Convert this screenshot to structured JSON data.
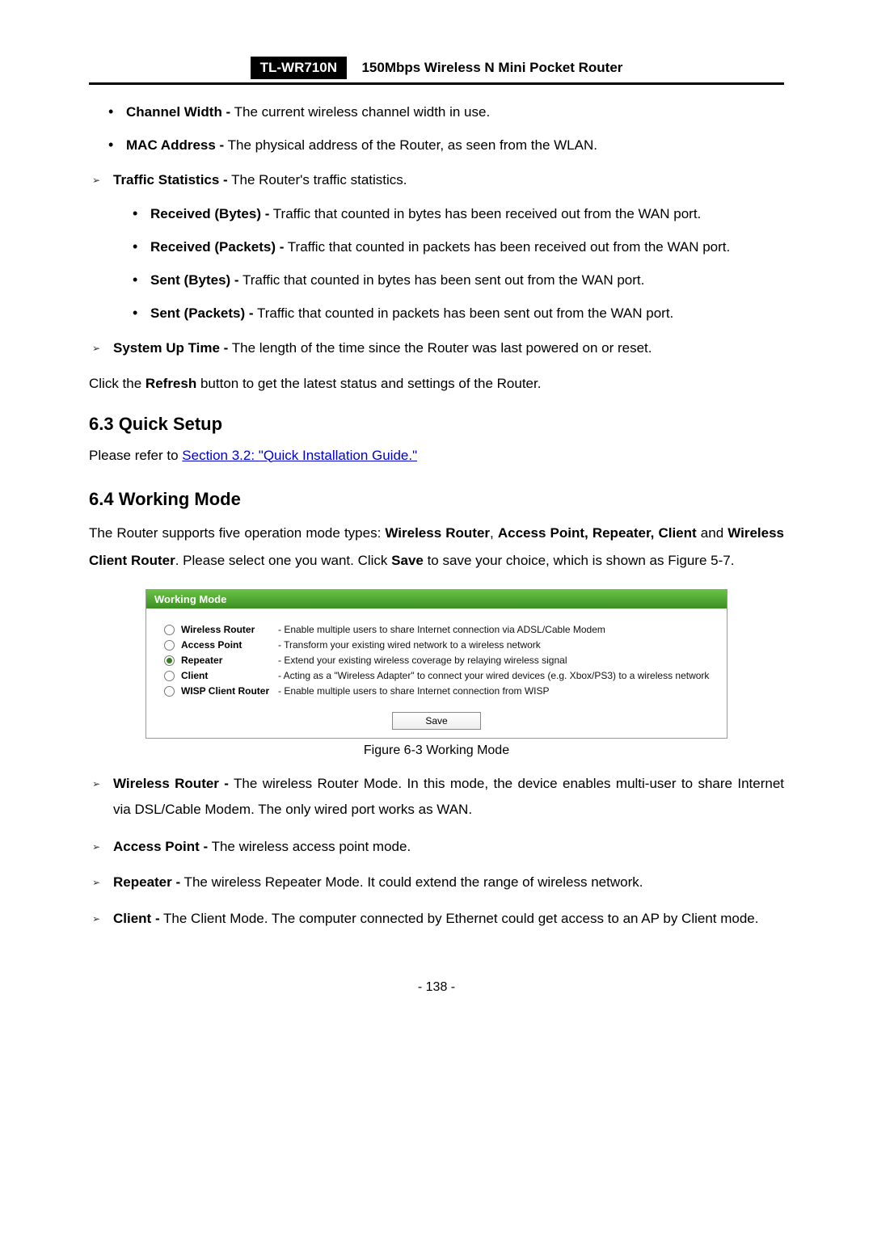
{
  "header": {
    "model": "TL-WR710N",
    "desc": "150Mbps  Wireless  N  Mini  Pocket  Router"
  },
  "top_bullets": [
    {
      "bold": "Channel Width -",
      "rest": " The current wireless channel width in use."
    },
    {
      "bold": "MAC Address -",
      "rest": " The physical address of the Router, as seen from the WLAN."
    }
  ],
  "traffic_stats": {
    "bold": "Traffic Statistics -",
    "rest": " The Router's traffic statistics.",
    "items": [
      {
        "bold": "Received (Bytes) -",
        "rest": " Traffic that counted in bytes has been received out from the WAN port."
      },
      {
        "bold": "Received (Packets) -",
        "rest": " Traffic that counted in packets has been received out from the WAN port."
      },
      {
        "bold": "Sent (Bytes) -",
        "rest": " Traffic that counted in bytes has been sent out from the WAN port."
      },
      {
        "bold": "Sent (Packets) -",
        "rest": " Traffic that counted in packets has been sent out from the WAN port."
      }
    ]
  },
  "system_up": {
    "bold": "System Up Time -",
    "rest": " The length of the time since the Router was last powered on or reset."
  },
  "refresh_line": {
    "pre": "Click the ",
    "bold": "Refresh",
    "post": " button to get the latest status and settings of the Router."
  },
  "sec_63_title": "6.3  Quick Setup",
  "sec_63_pre": "Please refer to ",
  "sec_63_link": "Section 3.2: \"Quick Installation Guide.\"",
  "sec_64_title": "6.4  Working Mode",
  "sec_64_para": {
    "p1": "The  Router  supports  five  operation  mode  types:  ",
    "b1": "Wireless  Router",
    "c1": ",  ",
    "b2": "Access  Point,  Repeater, Client",
    "c2": " and ",
    "b3": "Wireless Client Router",
    "c3": ". Please select one you want. Click ",
    "b4": "Save",
    "c4": " to save your choice, which is shown as Figure 5-7."
  },
  "figure": {
    "title": "Working Mode",
    "modes": [
      {
        "label": "Wireless Router",
        "desc": "- Enable multiple users to share Internet connection via ADSL/Cable Modem",
        "selected": false
      },
      {
        "label": "Access Point",
        "desc": "- Transform your existing wired network to a wireless network",
        "selected": false
      },
      {
        "label": "Repeater",
        "desc": "- Extend your existing wireless coverage by relaying wireless signal",
        "selected": true
      },
      {
        "label": "Client",
        "desc": "- Acting as a \"Wireless Adapter\" to connect your wired devices (e.g. Xbox/PS3) to a wireless network",
        "selected": false
      },
      {
        "label": "WISP Client Router",
        "desc": "- Enable multiple users to share Internet connection from WISP",
        "selected": false
      }
    ],
    "save": "Save",
    "caption": "Figure 6-3 Working Mode"
  },
  "mode_defs": [
    {
      "bold": "Wireless Router -",
      "rest": " The wireless Router Mode. In this mode, the device enables multi-user to share Internet via DSL/Cable Modem. The only wired port works as WAN."
    },
    {
      "bold": "Access Point -",
      "rest": " The wireless access point mode."
    },
    {
      "bold": "Repeater -",
      "rest": " The wireless Repeater Mode. It could extend the range of wireless network."
    },
    {
      "bold": "Client -",
      "rest": " The Client Mode. The computer connected by Ethernet could get access to an AP by Client mode."
    }
  ],
  "page_number": "- 138 -"
}
